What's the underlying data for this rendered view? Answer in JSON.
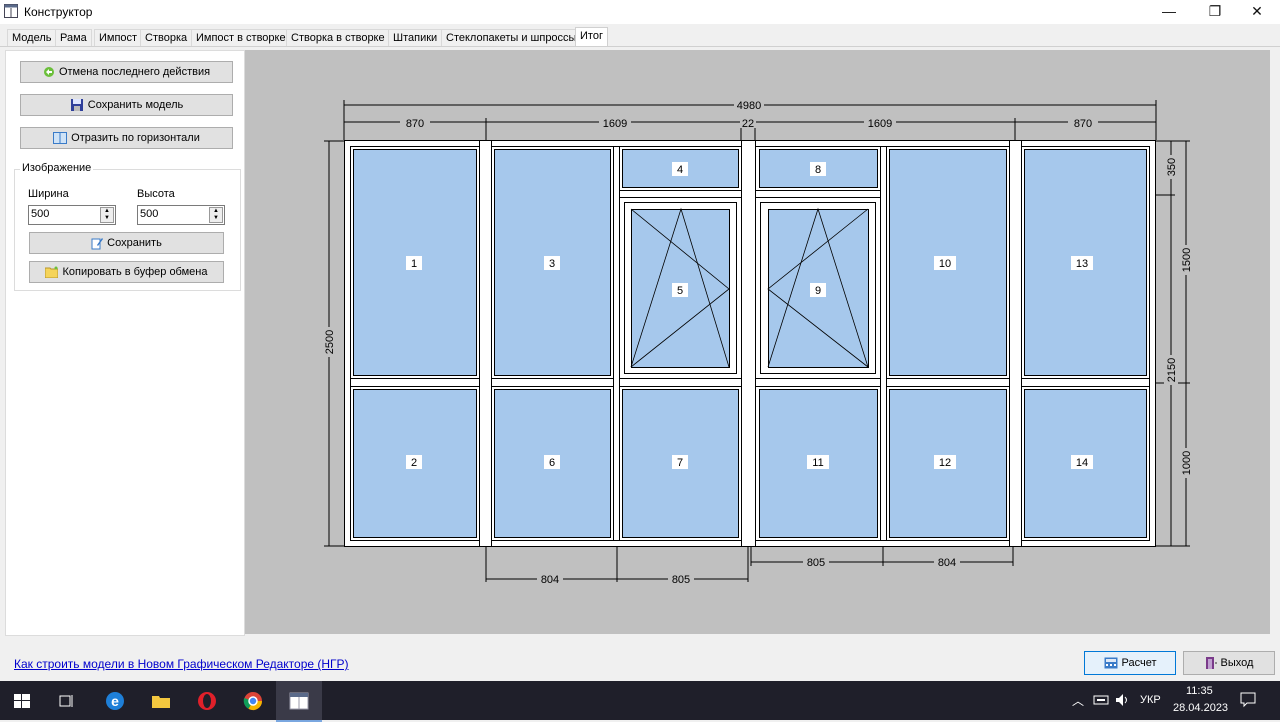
{
  "window": {
    "title": "Конструктор"
  },
  "tabs": [
    "Модель",
    "Рама",
    "Импост",
    "Створка",
    "Импост в створке",
    "Створка в створке",
    "Штапики",
    "Стеклопакеты и шпроссы",
    "Итог"
  ],
  "active_tab": "Итог",
  "left_panel": {
    "undo_label": "Отмена последнего действия",
    "save_model_label": "Сохранить модель",
    "mirror_label": "Отразить по горизонтали",
    "image_group_title": "Изображение",
    "width_label": "Ширина",
    "height_label": "Высота",
    "width_value": "500",
    "height_value": "500",
    "save_label": "Сохранить",
    "copy_label": "Копировать в буфер обмена"
  },
  "drawing": {
    "total_width": "4980",
    "top_widths": [
      "870",
      "1609",
      "22",
      "1609",
      "870"
    ],
    "total_height": "2500",
    "right_heights": [
      "350",
      "1500",
      "2150",
      "1000"
    ],
    "bottom_left": [
      "804",
      "805"
    ],
    "bottom_right": [
      "805",
      "804"
    ],
    "panes": [
      "1",
      "2",
      "3",
      "4",
      "5",
      "6",
      "7",
      "8",
      "9",
      "10",
      "11",
      "12",
      "13",
      "14"
    ]
  },
  "bottom": {
    "help_link": "Как строить модели в Новом Графическом Редакторе (НГР)",
    "calc_label": "Расчет",
    "exit_label": "Выход"
  },
  "taskbar": {
    "lang": "УКР",
    "time": "11:35",
    "date": "28.04.2023"
  },
  "colors": {
    "glass": "#a6c8ec",
    "canvas_bg": "#c0c0c0",
    "frame": "#ffffff",
    "link": "#0000cc"
  }
}
